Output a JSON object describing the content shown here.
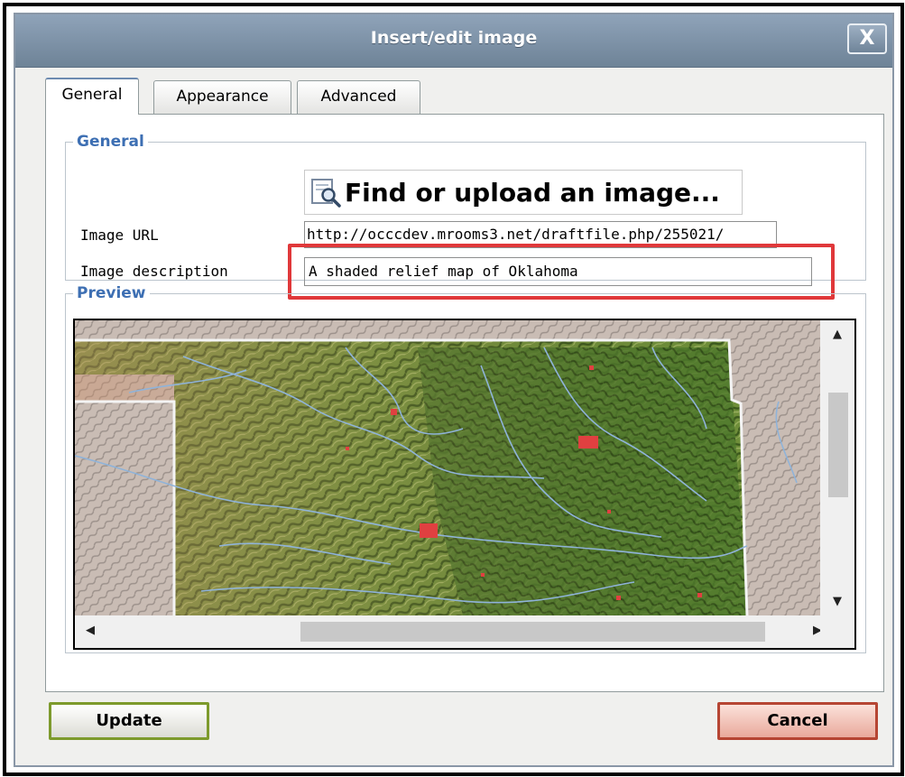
{
  "window": {
    "title": "Insert/edit image",
    "close_label": "X"
  },
  "tabs": [
    {
      "label": "General",
      "active": true
    },
    {
      "label": "Appearance",
      "active": false
    },
    {
      "label": "Advanced",
      "active": false
    }
  ],
  "general": {
    "legend": "General",
    "find_button": "Find or upload an image...",
    "url_label": "Image URL",
    "url_value": "http://occcdev.mrooms3.net/draftfile.php/255021/",
    "desc_label": "Image description",
    "desc_value": "A shaded relief map of Oklahoma"
  },
  "preview": {
    "legend": "Preview",
    "image": "shaded-relief-map-of-oklahoma"
  },
  "buttons": {
    "update": "Update",
    "cancel": "Cancel"
  },
  "colors": {
    "titlebar": "#7b8fa4",
    "legend": "#3d6fb3",
    "highlight": "#e0383a",
    "update_border": "#7d9a2c",
    "cancel_fill": "#e9a99b"
  }
}
